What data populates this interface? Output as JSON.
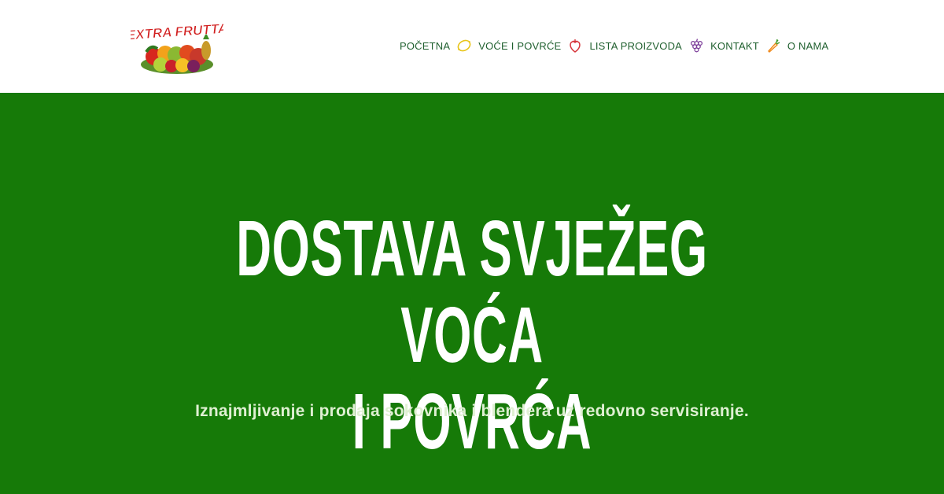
{
  "brand": {
    "logo_text": "EXTRA FRUTTA"
  },
  "nav": {
    "items": [
      {
        "label": "POČETNA",
        "icon": "lemon-icon"
      },
      {
        "label": "VOĆE I POVRĆE",
        "icon": "strawberry-icon"
      },
      {
        "label": "LISTA PROIZVODA",
        "icon": "grapes-icon"
      },
      {
        "label": "KONTAKT",
        "icon": "carrot-icon"
      },
      {
        "label": "O NAMA",
        "icon": null
      }
    ]
  },
  "hero": {
    "title_line1": "DOSTAVA SVJEŽEG VOĆA",
    "title_line2": "I POVRĆA",
    "subtitle": "Iznajmljivanje i prodaja sokovnika i blendera uz redovno servisiranje."
  },
  "colors": {
    "hero_background": "#167a08",
    "nav_text": "#1f5f2e",
    "hero_title": "#ffffff",
    "hero_subtitle": "#dff0d2"
  }
}
